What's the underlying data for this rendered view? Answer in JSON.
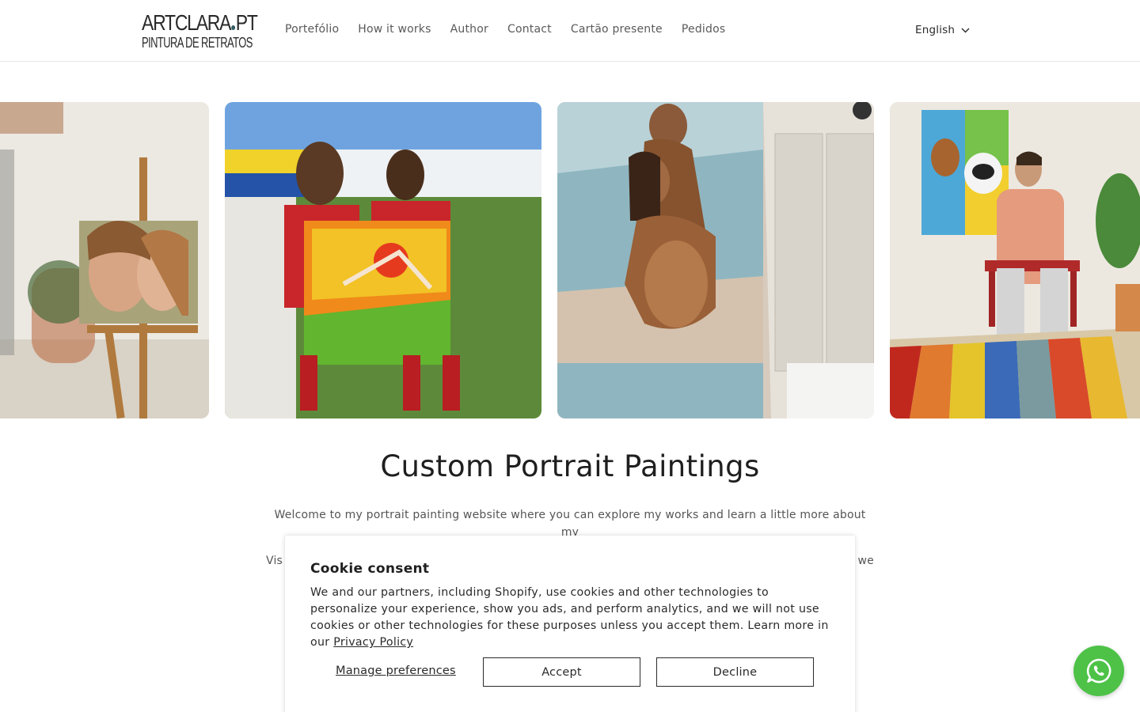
{
  "header": {
    "logo_line1": "ARTCLARA",
    "logo_line1_suffix": "PT",
    "logo_line2": "PINTURA DE RETRATOS",
    "nav": [
      "Portefólio",
      "How it works",
      "Author",
      "Contact",
      "Cartão presente",
      "Pedidos"
    ],
    "language": "English"
  },
  "hero": {
    "title": "Custom Portrait Paintings",
    "intro_line1": "Welcome to my portrait painting website where you can explore my works and learn a little more about my",
    "intro_line2_start": "Vis",
    "intro_line2_end": "we"
  },
  "cookie": {
    "title": "Cookie consent",
    "body": "We and our partners, including Shopify, use cookies and other technologies to personalize your experience, show you ads, and perform analytics, and we will not use cookies or other technologies for these purposes unless you accept them. Learn more in our ",
    "privacy_link": "Privacy Policy",
    "manage_label": "Manage preferences",
    "accept_label": "Accept",
    "decline_label": "Decline"
  },
  "gallery": {
    "slides": [
      "couple-portrait-on-easel",
      "footballers-with-painting",
      "couple-beach-painting",
      "man-with-dogs-painting"
    ]
  },
  "colors": {
    "whatsapp": "#4dc247",
    "logo_dot": "#2f5d62"
  },
  "icons": {
    "language_caret": "chevron-down-icon",
    "whatsapp": "whatsapp-icon"
  }
}
